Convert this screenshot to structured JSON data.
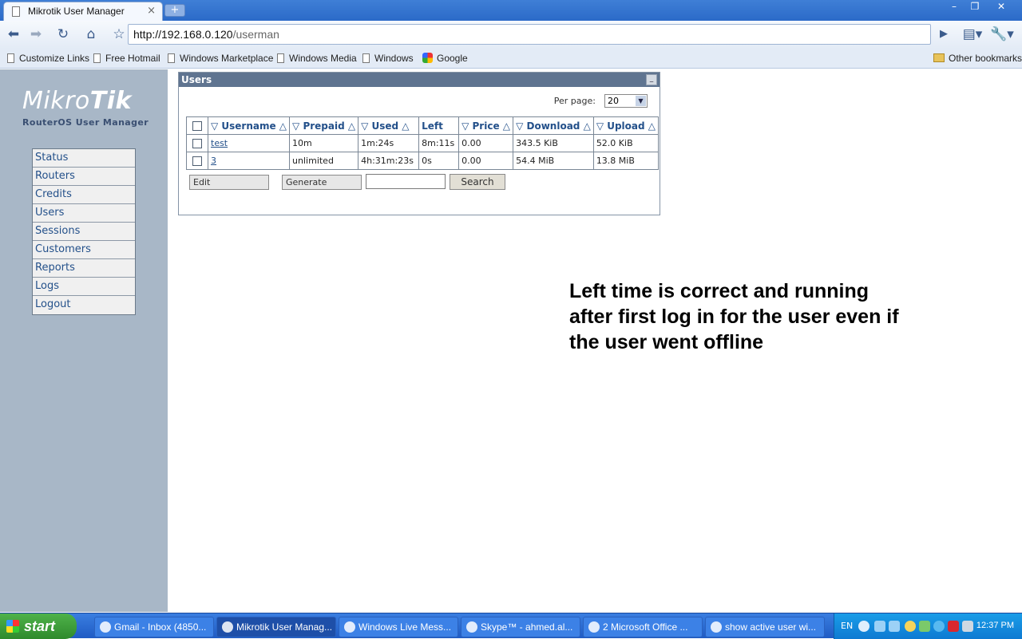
{
  "browser": {
    "tab_title": "Mikrotik User Manager",
    "tab_close": "×",
    "new_tab": "+",
    "window_buttons": [
      "–",
      "❐",
      "✕"
    ],
    "address_host": "http://192.168.0.120",
    "address_path": "/userman"
  },
  "bookmarks": [
    "Customize Links",
    "Free Hotmail",
    "Windows Marketplace",
    "Windows Media",
    "Windows",
    "Google"
  ],
  "other_bookmarks": "Other bookmarks",
  "brand": {
    "logo_light": "Mikro",
    "logo_bold": "Tik",
    "subtitle": "RouterOS User Manager"
  },
  "menu": [
    "Status",
    "Routers",
    "Credits",
    "Users",
    "Sessions",
    "Customers",
    "Reports",
    "Logs",
    "Logout"
  ],
  "panel": {
    "title": "Users",
    "minimize": "_",
    "per_page_label": "Per page:",
    "per_page_value": "20",
    "columns": [
      "▽ Username △",
      "▽ Prepaid △",
      "▽ Used △",
      "Left",
      "▽ Price △",
      "▽ Download △",
      "▽ Upload △"
    ],
    "rows": [
      [
        "test",
        "10m",
        "1m:24s",
        "8m:11s",
        "0.00",
        "343.5 KiB",
        "52.0 KiB"
      ],
      [
        "3",
        "unlimited",
        "4h:31m:23s",
        "0s",
        "0.00",
        "54.4 MiB",
        "13.8 MiB"
      ]
    ],
    "edit_label": "Edit",
    "generate_label": "Generate",
    "search_value": "",
    "search_label": "Search"
  },
  "note": "Left time is correct and running after first log in for the user even if the user went offline",
  "taskbar": {
    "start": "start",
    "tasks": [
      "Gmail - Inbox (4850...",
      "Mikrotik User Manag...",
      "Windows Live Mess...",
      "Skype™ - ahmed.al...",
      "2 Microsoft Office ...",
      "show active user wi..."
    ],
    "lang": "EN",
    "clock": "12:37 PM"
  }
}
